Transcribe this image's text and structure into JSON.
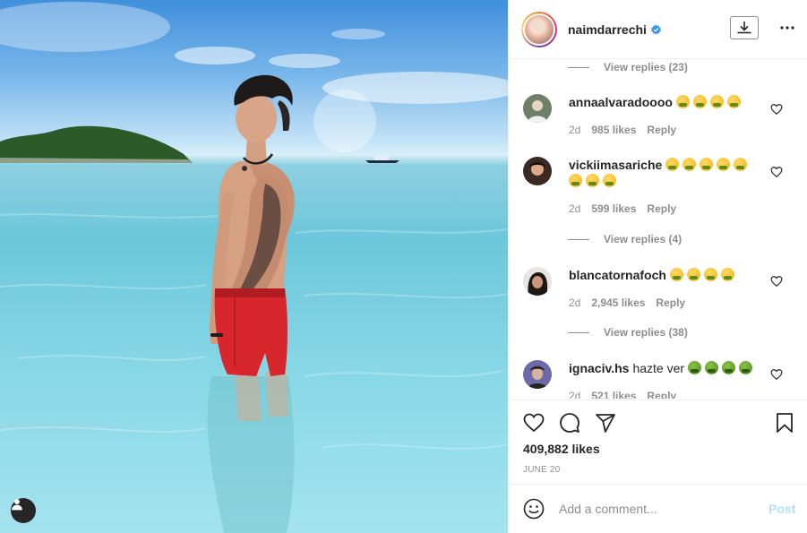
{
  "post": {
    "username": "naimdarrechi",
    "verified": true,
    "likes": "409,882 likes",
    "date": "June 20"
  },
  "comment_input": {
    "placeholder": "Add a comment...",
    "post_label": "Post"
  },
  "comments": [
    {
      "type": "replies",
      "label": "View replies (23)"
    },
    {
      "type": "comment",
      "username": "annaalvaradoooo",
      "text": "",
      "emojis": [
        "nauseated-face",
        "nauseated-face",
        "nauseated-face",
        "nauseated-face"
      ],
      "age": "2d",
      "likes": "985 likes",
      "reply": "Reply"
    },
    {
      "type": "comment",
      "username": "vickiimasariche",
      "text": "",
      "emojis": [
        "nauseated-face",
        "nauseated-face",
        "nauseated-face",
        "nauseated-face",
        "nauseated-face",
        "nauseated-face",
        "nauseated-face",
        "nauseated-face"
      ],
      "age": "2d",
      "likes": "599 likes",
      "reply": "Reply"
    },
    {
      "type": "replies",
      "label": "View replies (4)"
    },
    {
      "type": "comment",
      "username": "blancatornafoch",
      "text": "",
      "emojis": [
        "nauseated-face",
        "nauseated-face",
        "nauseated-face",
        "nauseated-face"
      ],
      "age": "2d",
      "likes": "2,945 likes",
      "reply": "Reply"
    },
    {
      "type": "replies",
      "label": "View replies (38)"
    },
    {
      "type": "comment",
      "username": "ignaciv.hs",
      "text": "hazte ver",
      "emojis": [
        "nauseated-face-green",
        "nauseated-face-green",
        "nauseated-face-green",
        "nauseated-face-green"
      ],
      "age": "2d",
      "likes": "521 likes",
      "reply": "Reply"
    }
  ],
  "colors": {
    "link_muted": "#8e8e8e",
    "post_disabled": "#b2dffc",
    "verified_blue": "#3897f0",
    "shorts_red": "#d8262d"
  }
}
